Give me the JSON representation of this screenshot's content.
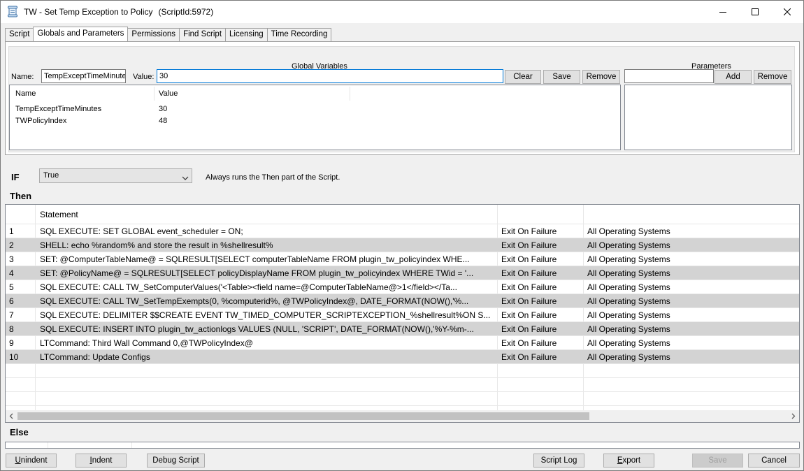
{
  "window": {
    "title": "TW - Set Temp Exception to Policy",
    "script_id": "(ScriptId:5972)"
  },
  "tabs": [
    {
      "label": "Script",
      "active": false
    },
    {
      "label": "Globals and Parameters",
      "active": true
    },
    {
      "label": "Permissions",
      "active": false
    },
    {
      "label": "Find Script",
      "active": false
    },
    {
      "label": "Licensing",
      "active": false
    },
    {
      "label": "Time Recording",
      "active": false
    }
  ],
  "globals": {
    "title": "Global Variables",
    "name_label": "Name:",
    "name_value": "TempExceptTimeMinutes",
    "value_label": "Value:",
    "value_value": "30",
    "clear_label": "Clear",
    "save_label": "Save",
    "remove_label": "Remove",
    "columns": [
      "Name",
      "Value"
    ],
    "rows": [
      {
        "name": "TempExceptTimeMinutes",
        "value": "30"
      },
      {
        "name": "TWPolicyIndex",
        "value": "48"
      }
    ]
  },
  "parameters": {
    "title": "Parameters",
    "input_value": "",
    "add_label": "Add",
    "remove_label": "Remove"
  },
  "condition": {
    "if_label": "IF",
    "selected": "True",
    "description": "Always runs the Then part of the Script."
  },
  "then": {
    "label": "Then",
    "header": "Statement",
    "rows": [
      {
        "num": "1",
        "statement": "SQL EXECUTE: SET GLOBAL event_scheduler = ON;",
        "onfail": "Exit On Failure",
        "os": "All Operating Systems"
      },
      {
        "num": "2",
        "statement": "SHELL:  echo %random% and store the result in %shellresult%",
        "onfail": "Exit On Failure",
        "os": "All Operating Systems"
      },
      {
        "num": "3",
        "statement": "SET:  @ComputerTableName@ = SQLRESULT[SELECT computerTableName FROM plugin_tw_policyindex WHE...",
        "onfail": "Exit On Failure",
        "os": "All Operating Systems"
      },
      {
        "num": "4",
        "statement": "SET:  @PolicyName@ = SQLRESULT[SELECT policyDisplayName FROM plugin_tw_policyindex WHERE TWid = '...",
        "onfail": "Exit On Failure",
        "os": "All Operating Systems"
      },
      {
        "num": "5",
        "statement": "SQL EXECUTE: CALL TW_SetComputerValues('<Table><field name=@ComputerTableName@>1</field></Ta...",
        "onfail": "Exit On Failure",
        "os": "All Operating Systems"
      },
      {
        "num": "6",
        "statement": "SQL EXECUTE: CALL TW_SetTempExempts(0, %computerid%, @TWPolicyIndex@, DATE_FORMAT(NOW(),'%...",
        "onfail": "Exit On Failure",
        "os": "All Operating Systems"
      },
      {
        "num": "7",
        "statement": "SQL EXECUTE: DELIMITER $$CREATE EVENT TW_TIMED_COMPUTER_SCRIPTEXCEPTION_%shellresult%ON S...",
        "onfail": "Exit On Failure",
        "os": "All Operating Systems"
      },
      {
        "num": "8",
        "statement": "SQL EXECUTE: INSERT INTO plugin_tw_actionlogs VALUES (NULL, 'SCRIPT', DATE_FORMAT(NOW(),'%Y-%m-...",
        "onfail": "Exit On Failure",
        "os": "All Operating Systems"
      },
      {
        "num": "9",
        "statement": "LTCommand: Third Wall Command 0,@TWPolicyIndex@",
        "onfail": "Exit On Failure",
        "os": "All Operating Systems"
      },
      {
        "num": "10",
        "statement": "LTCommand: Update Configs",
        "onfail": "Exit On Failure",
        "os": "All Operating Systems"
      }
    ]
  },
  "else": {
    "label": "Else"
  },
  "footer": {
    "unindent_first": "U",
    "unindent_rest": "nindent",
    "indent_first": "I",
    "indent_rest": "ndent",
    "debug_label": "Debug Script",
    "scriptlog_label": "Script Log",
    "export_first": "E",
    "export_rest": "xport",
    "save_label": "Save",
    "cancel_label": "Cancel"
  }
}
